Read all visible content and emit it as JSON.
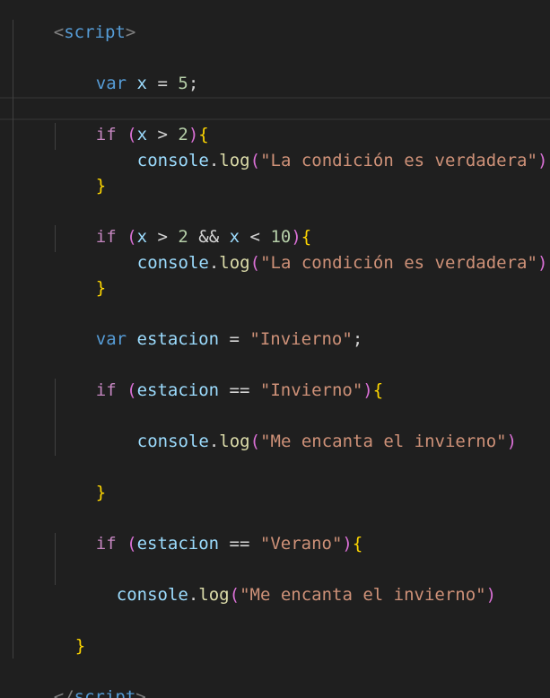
{
  "code": {
    "open_tag": {
      "lt": "<",
      "name": "script",
      "gt": ">"
    },
    "l1": {
      "kw": "var",
      "name": "x",
      "op": "=",
      "num": "5",
      "semi": ";"
    },
    "l2": {
      "kw": "if",
      "open": "(",
      "var": "x",
      "op": ">",
      "num": "2",
      "close": ")",
      "brace": "{"
    },
    "l3": {
      "obj": "console",
      "dot": ".",
      "fn": "log",
      "open": "(",
      "str": "\"La condición es verdadera\"",
      "close": ")",
      "semi": ";"
    },
    "l4": {
      "brace": "}"
    },
    "l5": {
      "kw": "if",
      "open": "(",
      "var1": "x",
      "op1": ">",
      "num1": "2",
      "and": "&&",
      "var2": "x",
      "op2": "<",
      "num2": "10",
      "close": ")",
      "brace": "{"
    },
    "l6": {
      "obj": "console",
      "dot": ".",
      "fn": "log",
      "open": "(",
      "str": "\"La condición es verdadera\"",
      "close": ")",
      "semi": ";"
    },
    "l7": {
      "brace": "}"
    },
    "l8": {
      "kw": "var",
      "name": "estacion",
      "op": "=",
      "str": "\"Invierno\"",
      "semi": ";"
    },
    "l9": {
      "kw": "if",
      "open": "(",
      "var": "estacion",
      "op": "==",
      "str": "\"Invierno\"",
      "close": ")",
      "brace": "{"
    },
    "l10": {
      "obj": "console",
      "dot": ".",
      "fn": "log",
      "open": "(",
      "str": "\"Me encanta el invierno\"",
      "close": ")"
    },
    "l11": {
      "brace": "}"
    },
    "l12": {
      "kw": "if",
      "open": "(",
      "var": "estacion",
      "op": "==",
      "str": "\"Verano\"",
      "close": ")",
      "brace": "{"
    },
    "l13": {
      "obj": "console",
      "dot": ".",
      "fn": "log",
      "open": "(",
      "str": "\"Me encanta el invierno\"",
      "close": ")"
    },
    "l14": {
      "brace": "}"
    },
    "close_tag": {
      "lt": "</",
      "name": "script",
      "gt": ">"
    }
  }
}
